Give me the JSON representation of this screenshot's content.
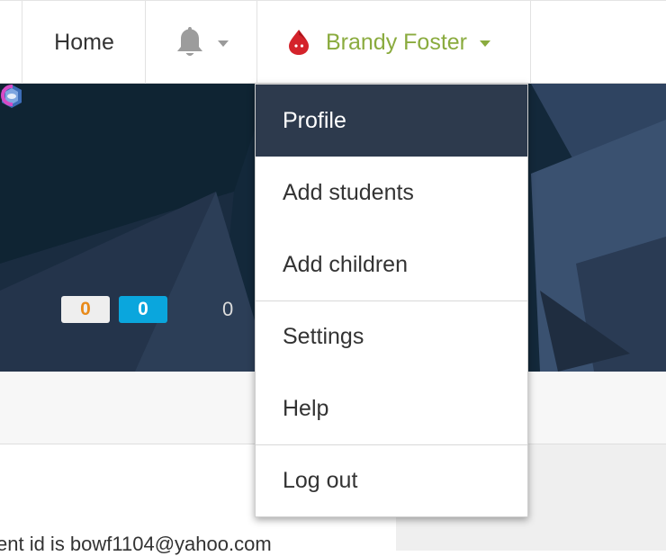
{
  "nav": {
    "home_label": "Home",
    "notifications_icon": "bell-icon",
    "user_name": "Brandy Foster",
    "user_avatar_icon": "red-drop-avatar-icon",
    "user_color": "#8aab3e"
  },
  "hero": {
    "badge_orange_value": "0",
    "badge_blue_value": "0",
    "stat_value": "0"
  },
  "menu": {
    "items": [
      {
        "label": "Profile",
        "active": true
      },
      {
        "label": "Add students"
      },
      {
        "label": "Add children"
      },
      {
        "label": "Settings"
      },
      {
        "label": "Help"
      },
      {
        "label": "Log out"
      }
    ]
  },
  "content": {
    "text": "ent id is bowf1104@yahoo.com"
  },
  "colors": {
    "accent_green": "#8aab3e",
    "menu_active_bg": "#2d3a4d",
    "badge_blue": "#0aa6dd",
    "badge_orange_text": "#e88a1a"
  }
}
